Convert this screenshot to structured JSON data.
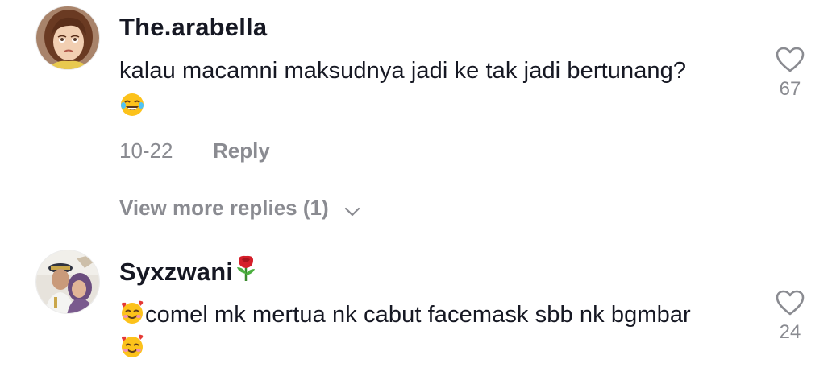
{
  "comments": [
    {
      "username": "The.arabella",
      "text": "kalau macamni maksudnya jadi ke tak jadi bertunang?",
      "trailing_emoji": "face-with-tears-of-joy-icon",
      "date": "10-22",
      "reply_label": "Reply",
      "like_count": "67",
      "view_more_label": "View more replies (1)"
    },
    {
      "username": "Syxzwani",
      "username_emoji": "rose-icon",
      "text": "comel mk mertua nk cabut facemask sbb nk bgmbar",
      "leading_emoji": "smiling-face-with-hearts-icon",
      "trailing_emoji": "smiling-face-with-hearts-icon",
      "like_count": "24"
    }
  ],
  "colors": {
    "primary_text": "#161823",
    "secondary_text": "#8a8b91",
    "background": "#ffffff"
  }
}
